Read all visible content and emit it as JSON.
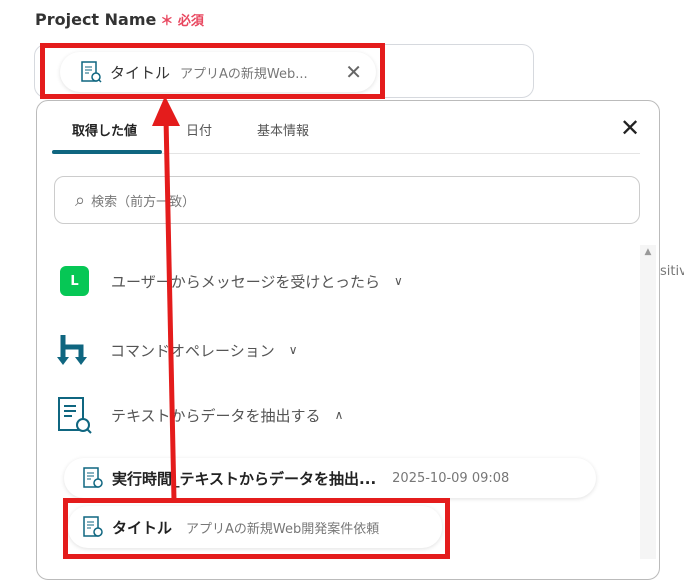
{
  "field": {
    "label": "Project Name",
    "required_mark": "＊",
    "required_text": "必須",
    "chip": {
      "name": "タイトル",
      "value": "アプリAの新規Web..."
    }
  },
  "panel": {
    "tabs": [
      "取得した値",
      "日付",
      "基本情報"
    ],
    "search_placeholder": "検索（前方一致）",
    "groups": [
      {
        "label": "ユーザーからメッセージを受けとったら",
        "icon": "line-icon",
        "expanded": false
      },
      {
        "label": "コマンドオペレーション",
        "icon": "command-icon",
        "expanded": false
      },
      {
        "label": "テキストからデータを抽出する",
        "icon": "text-extract-icon",
        "expanded": true
      }
    ],
    "items": [
      {
        "name": "実行時間_テキストからデータを抽出...",
        "value": "2025-10-09 09:08"
      },
      {
        "name": "タイトル",
        "value": "アプリAの新規Web開発案件依頼"
      }
    ]
  },
  "background_text": "sitiv",
  "colors": {
    "accent": "#0f6680",
    "highlight": "#e41c1c",
    "line": "#06c755"
  }
}
